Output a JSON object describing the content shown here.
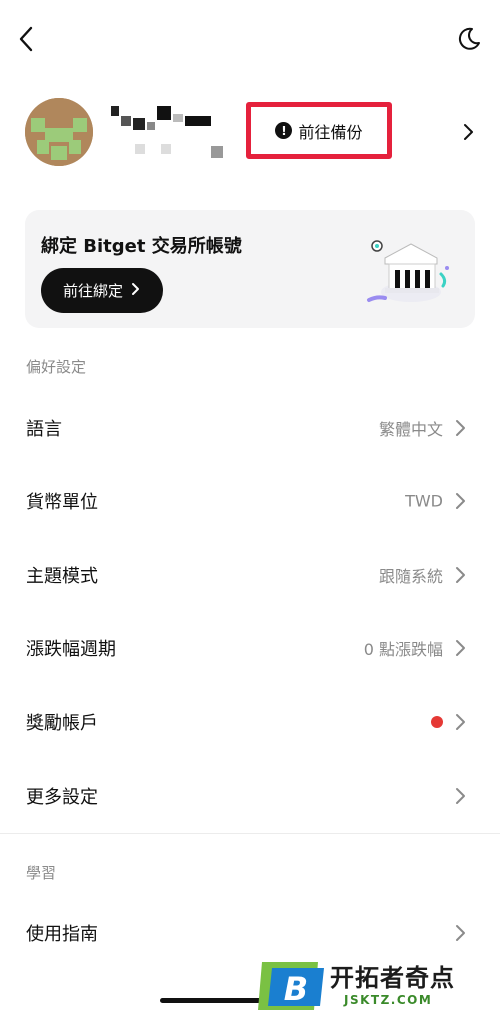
{
  "header": {
    "back_icon": "chevron-left-icon",
    "theme_icon": "moon-icon"
  },
  "profile": {
    "backup_button": "前往備份",
    "warning_icon": "exclamation-circle-icon",
    "chevron_icon": "chevron-right-icon"
  },
  "bind_card": {
    "title": "綁定 Bitget 交易所帳號",
    "button": "前往綁定",
    "button_chevron": "›"
  },
  "sections": {
    "preferences": "偏好設定",
    "learning": "學習"
  },
  "preferences": [
    {
      "label": "語言",
      "value": "繁體中文"
    },
    {
      "label": "貨幣單位",
      "value": "TWD"
    },
    {
      "label": "主題模式",
      "value": "跟隨系統"
    },
    {
      "label": "漲跌幅週期",
      "value": "0 點漲跌幅"
    },
    {
      "label": "獎勵帳戶",
      "value": ""
    },
    {
      "label": "更多設定",
      "value": ""
    }
  ],
  "learning": [
    {
      "label": "使用指南"
    }
  ],
  "watermark": {
    "logo_letter": "B",
    "cn": "开拓者奇点",
    "en": "JSKTZ.COM"
  },
  "colors": {
    "highlight_border": "#e5213c",
    "red_dot": "#e53935",
    "card_bg": "#f4f4f5",
    "button_bg": "#111111"
  }
}
